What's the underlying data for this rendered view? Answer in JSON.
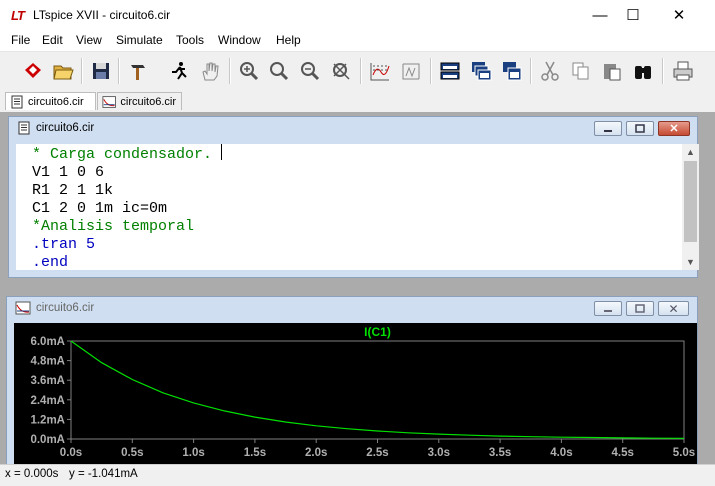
{
  "window": {
    "app_title": "LTspice XVII - circuito6.cir",
    "app_logo": "LT"
  },
  "menu": [
    "File",
    "Edit",
    "View",
    "Simulate",
    "Tools",
    "Window",
    "Help"
  ],
  "toolbar_icons": [
    "new-schematic-icon",
    "open-folder-icon",
    "save-icon",
    "control-panel-hammer-icon",
    "run-simulation-icon",
    "halt-hand-icon",
    "zoom-in-icon",
    "zoom-out-icon",
    "zoom-back-icon",
    "zoom-fit-icon",
    "autorange-icon",
    "fft-icon",
    "tile-horizontal-icon",
    "cascade-icon",
    "tile-vertical-icon",
    "cut-icon",
    "copy-icon",
    "paste-icon",
    "find-binoculars-icon",
    "print-icon"
  ],
  "tabs": [
    {
      "label": "circuito6.cir",
      "active": true
    },
    {
      "label": "circuito6.cir",
      "active": false
    }
  ],
  "netlist_window": {
    "title": "circuito6.cir",
    "lines": [
      {
        "text": "* Carga condensador.",
        "color": "#008000"
      },
      {
        "text": "V1 1 0 6",
        "color": "#000000"
      },
      {
        "text": "R1 2 1 1k",
        "color": "#000000"
      },
      {
        "text": "C1 2 0 1m ic=0m",
        "color": "#000000"
      },
      {
        "text": "*Analisis temporal",
        "color": "#008000"
      },
      {
        "text": ".tran 5",
        "color": "#0000c0"
      },
      {
        "text": ".end",
        "color": "#0000c0"
      }
    ]
  },
  "plot_window": {
    "title": "circuito6.cir"
  },
  "chart_data": {
    "type": "line",
    "title": "I(C1)",
    "series": [
      {
        "name": "I(C1)",
        "color": "#00e000",
        "x": [
          0,
          0.25,
          0.5,
          0.75,
          1.0,
          1.25,
          1.5,
          1.75,
          2.0,
          2.25,
          2.5,
          2.75,
          3.0,
          3.25,
          3.5,
          3.75,
          4.0,
          4.25,
          4.5,
          4.75,
          5.0
        ],
        "y": [
          6.0,
          4.67,
          3.64,
          2.83,
          2.21,
          1.72,
          1.34,
          1.04,
          0.81,
          0.63,
          0.49,
          0.38,
          0.3,
          0.23,
          0.18,
          0.14,
          0.11,
          0.09,
          0.07,
          0.05,
          0.04
        ]
      }
    ],
    "xticks": [
      "0.0s",
      "0.5s",
      "1.0s",
      "1.5s",
      "2.0s",
      "2.5s",
      "3.0s",
      "3.5s",
      "4.0s",
      "4.5s",
      "5.0s"
    ],
    "yticks": [
      "0.0mA",
      "1.2mA",
      "2.4mA",
      "3.6mA",
      "4.8mA",
      "6.0mA"
    ],
    "xlim": [
      0,
      5
    ],
    "ylim": [
      0,
      6.0
    ],
    "background": "#000000",
    "axis_color": "#808080",
    "label_color": "#b0b0b0",
    "title_color": "#00e000"
  },
  "status": {
    "x_readout": "x = 0.000s",
    "y_readout": "y = -1.041mA"
  }
}
